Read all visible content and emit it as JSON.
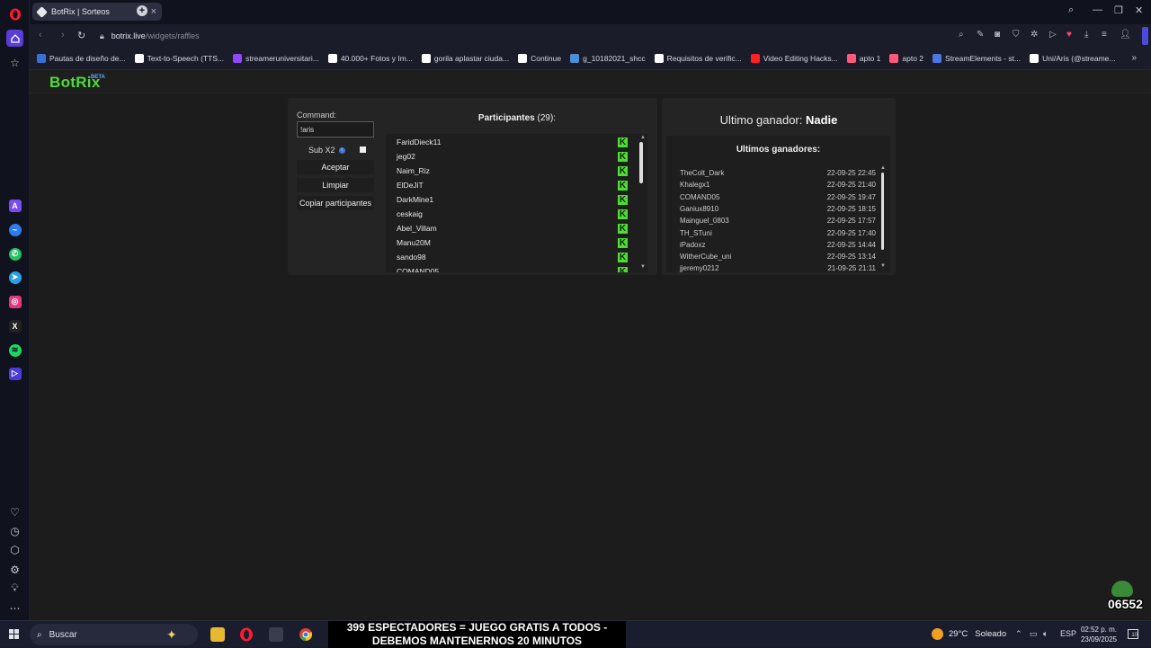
{
  "browser": {
    "tab_title": "BotRix | Sorteos",
    "url_domain": "botrix.live",
    "url_path": "/widgets/raffles",
    "bookmarks": [
      {
        "label": "Pautas de diseño de...",
        "color": "#3b6fd8"
      },
      {
        "label": "Text-to-Speech (TTS...",
        "color": "#ffffff"
      },
      {
        "label": "streameruniversitari...",
        "color": "#9146ff"
      },
      {
        "label": "40.000+ Fotos y Im...",
        "color": "#ffffff"
      },
      {
        "label": "gorila aplastar ciuda...",
        "color": "#ffffff"
      },
      {
        "label": "Continue",
        "color": "#ffffff"
      },
      {
        "label": "g_10182021_shcc",
        "color": "#4a90d9"
      },
      {
        "label": "Requisitos de verific...",
        "color": "#ffffff"
      },
      {
        "label": "Video Editing Hacks...",
        "color": "#ff2020"
      },
      {
        "label": "apto 1",
        "color": "#ff5a7a"
      },
      {
        "label": "apto 2",
        "color": "#ff5a7a"
      },
      {
        "label": "StreamElements - st...",
        "color": "#4a78e0"
      },
      {
        "label": "Uni/Aris (@streame...",
        "color": "#ffffff"
      }
    ]
  },
  "site": {
    "logo": "BotRix",
    "logo_badge": "BETA"
  },
  "raffle": {
    "command_label": "Command:",
    "command_value": "!aris",
    "sub_label": "Sub X2",
    "accept_label": "Aceptar",
    "clear_label": "Limpiar",
    "copy_label": "Copiar participantes",
    "participants_title": "Participantes",
    "participants_count": "(29):",
    "participants": [
      "FaridDieck11",
      "jeg02",
      "Naim_Riz",
      "ElDeJiT",
      "DarkMine1",
      "ceskaig",
      "Abel_Villam",
      "Manu20M",
      "sando98",
      "COMAND05"
    ],
    "badge_letter": "K"
  },
  "winners": {
    "last_winner_label": "Ultimo ganador:",
    "last_winner_name": "Nadie",
    "list_title": "Ultimos ganadores:",
    "list": [
      {
        "name": "TheColt_Dark",
        "date": "22-09-25 22:45"
      },
      {
        "name": "Khalegx1",
        "date": "22-09-25 21:40"
      },
      {
        "name": "COMAND05",
        "date": "22-09-25 19:47"
      },
      {
        "name": "Ganiux8910",
        "date": "22-09-25 18:15"
      },
      {
        "name": "Mainguel_0803",
        "date": "22-09-25 17:57"
      },
      {
        "name": "TH_STuni",
        "date": "22-09-25 17:40"
      },
      {
        "name": "iPadoxz",
        "date": "22-09-25 14:44"
      },
      {
        "name": "WitherCube_uni",
        "date": "22-09-25 13:14"
      },
      {
        "name": "jjeremy0212",
        "date": "21-09-25 21:11"
      }
    ]
  },
  "taskbar": {
    "search_placeholder": "Buscar",
    "banner_line1": "399 ESPECTADORES = JUEGO GRATIS A TODOS -",
    "banner_line2": "DEBEMOS MANTENERNOS 20 MINUTOS",
    "weather_temp": "29°C",
    "weather_desc": "Soleado",
    "lang": "ESP",
    "time": "02:52 p. m.",
    "date": "23/09/2025",
    "notif_count": "10"
  },
  "overlay": {
    "counter": "06552"
  }
}
